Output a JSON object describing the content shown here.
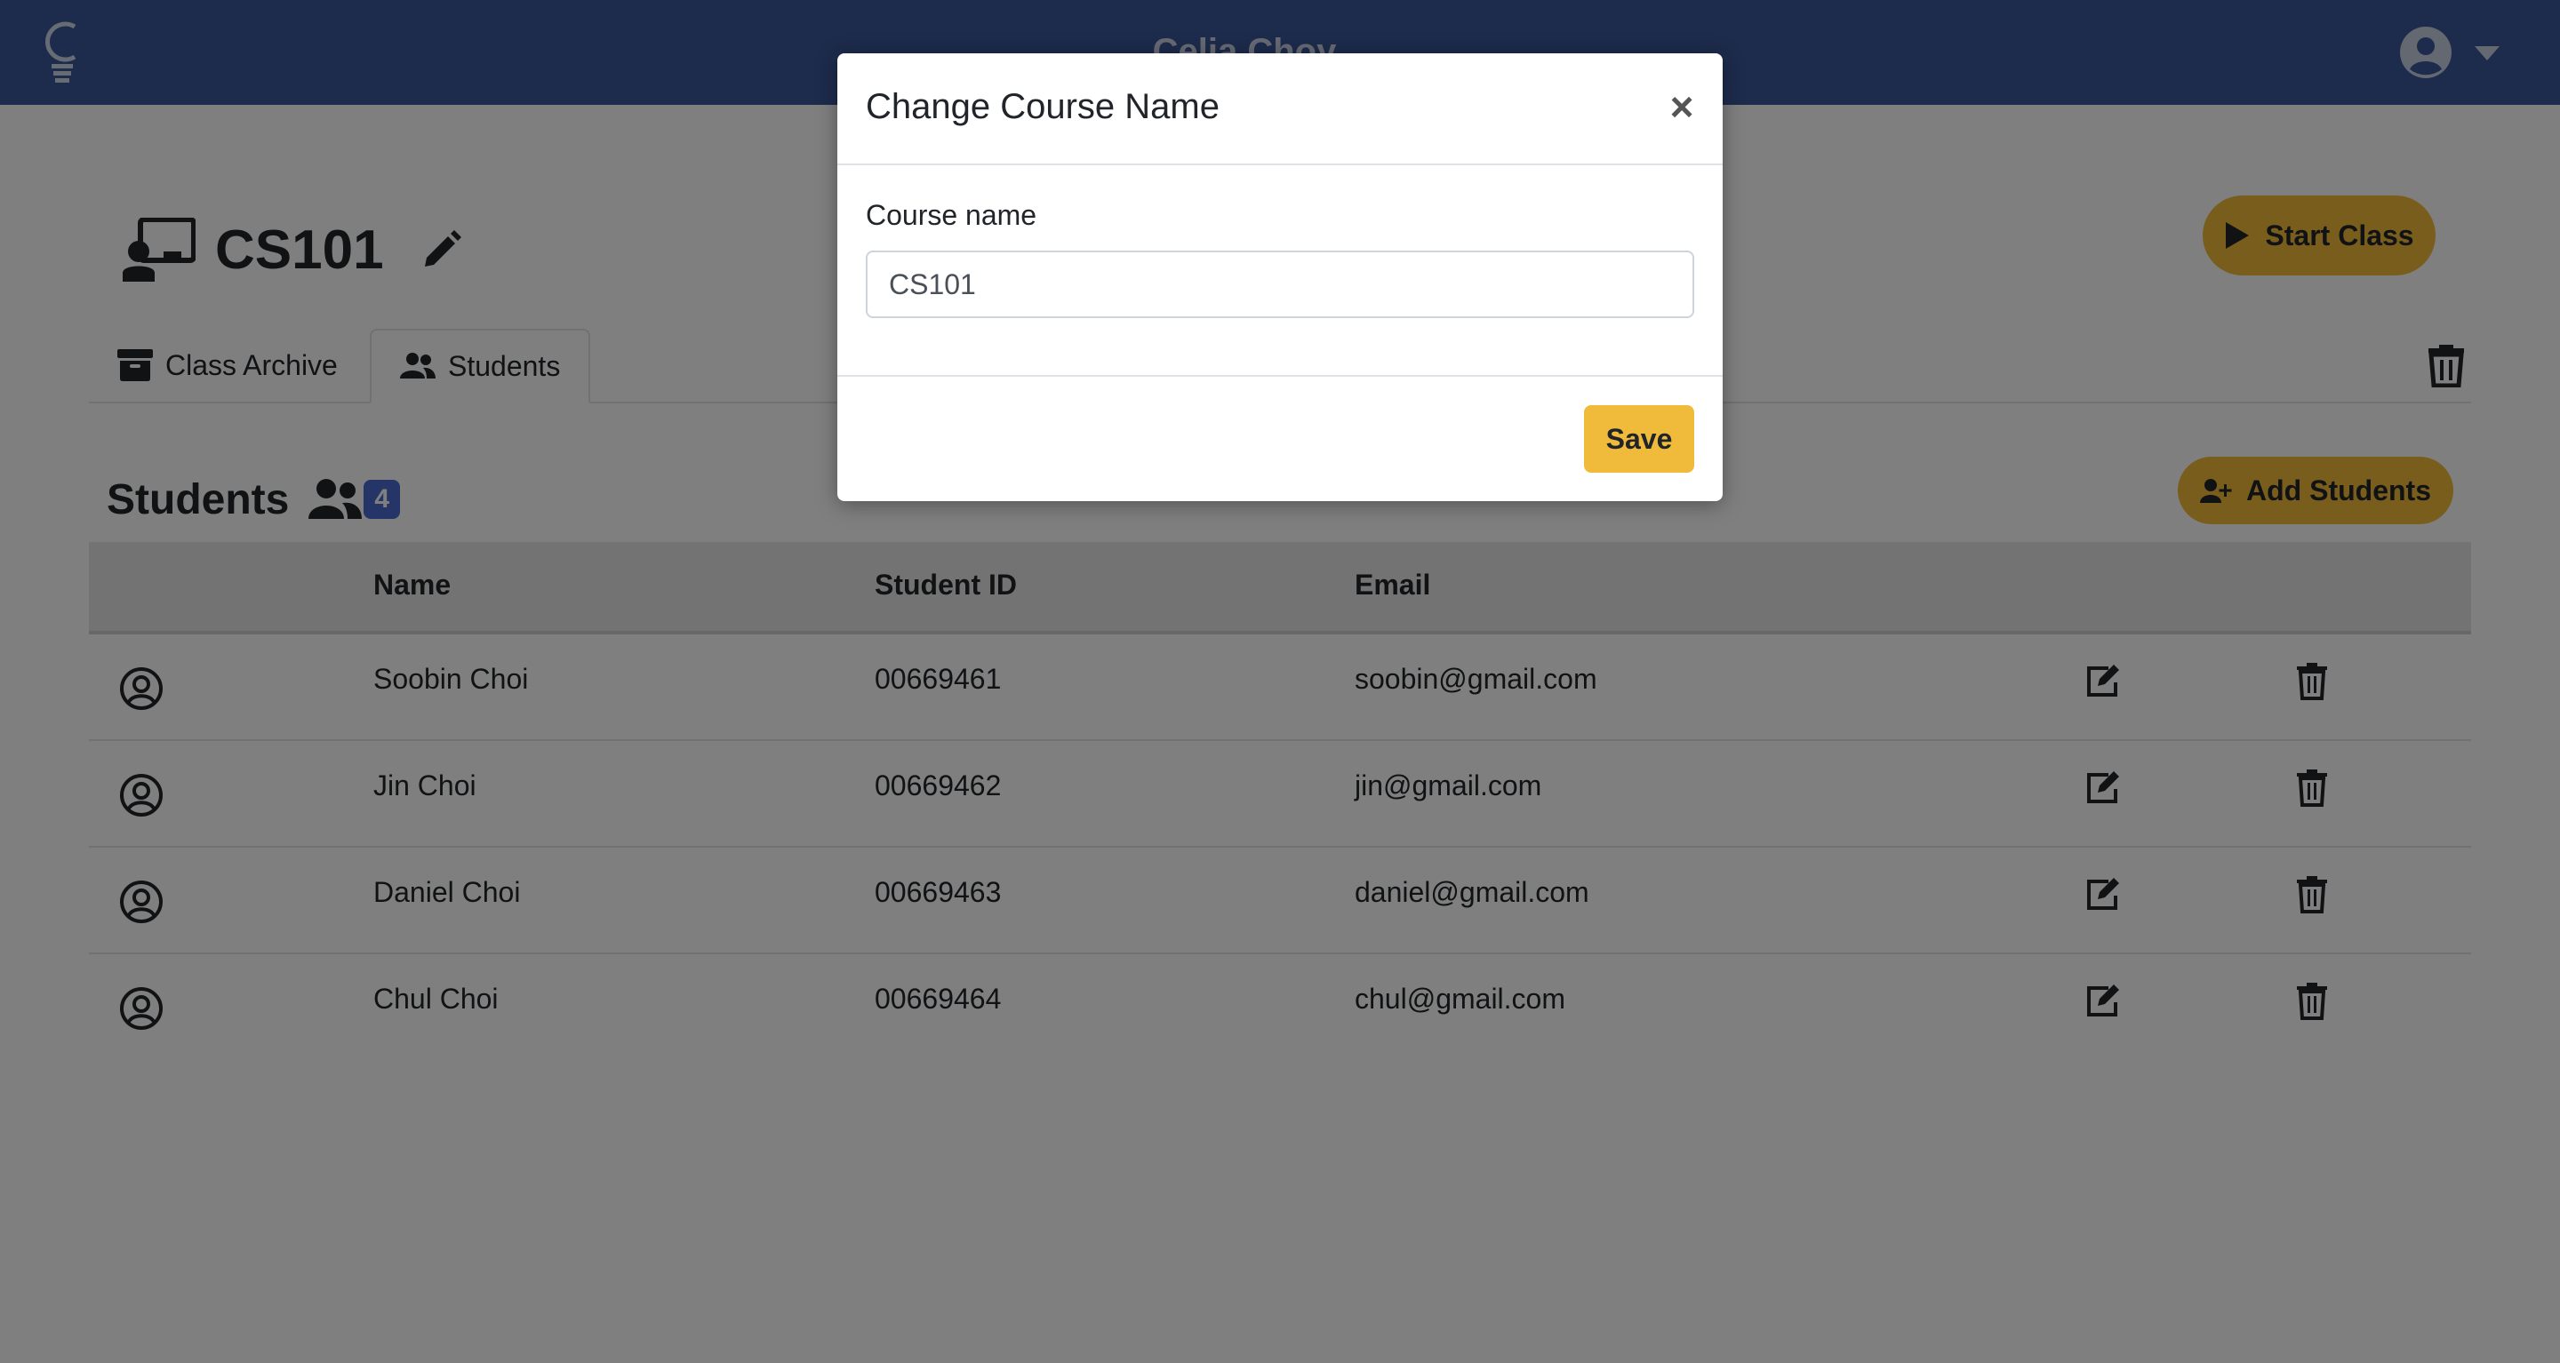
{
  "navbar": {
    "title": "Celia Choy"
  },
  "course": {
    "name": "CS101",
    "start_label": "Start Class"
  },
  "tabs": [
    {
      "label": "Class Archive"
    },
    {
      "label": "Students"
    }
  ],
  "students": {
    "title": "Students",
    "count": "4",
    "add_label": "Add Students",
    "columns": [
      "Name",
      "Student ID",
      "Email"
    ],
    "rows": [
      {
        "name": "Soobin Choi",
        "id": "00669461",
        "email": "soobin@gmail.com"
      },
      {
        "name": "Jin Choi",
        "id": "00669462",
        "email": "jin@gmail.com"
      },
      {
        "name": "Daniel Choi",
        "id": "00669463",
        "email": "daniel@gmail.com"
      },
      {
        "name": "Chul Choi",
        "id": "00669464",
        "email": "chul@gmail.com"
      }
    ]
  },
  "modal": {
    "title": "Change Course Name",
    "close_label": "×",
    "field_label": "Course name",
    "input_value": "CS101",
    "save_label": "Save"
  },
  "colors": {
    "navbar": "#3a5698",
    "accent": "#f0bb3a",
    "badge": "#4a6bd1"
  }
}
